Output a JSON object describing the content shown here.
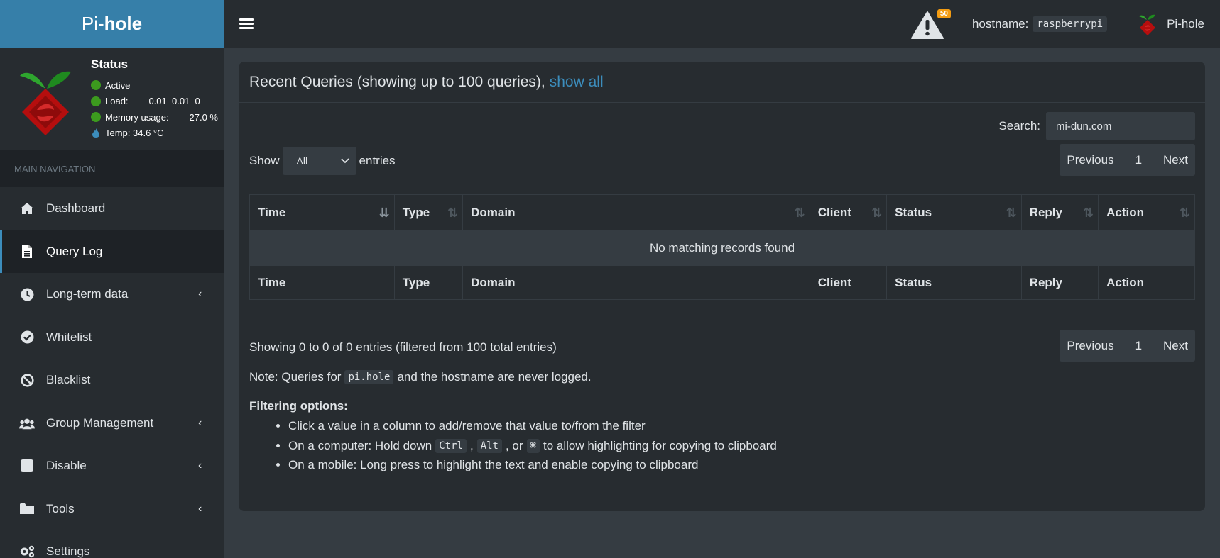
{
  "brand": {
    "pi": "Pi-",
    "hole": "hole"
  },
  "status": {
    "title": "Status",
    "active": "Active",
    "load_label": "Load:",
    "load_value": "0.01  0.01  0",
    "memory_label": "Memory usage:",
    "memory_value": "27.0 %",
    "temp": "Temp: 34.6 °C",
    "colors": {
      "ok": "#3c9a1e",
      "temp": "#3c8dbc"
    }
  },
  "nav": {
    "header": "MAIN NAVIGATION",
    "items": [
      {
        "label": "Dashboard",
        "icon": "home-icon",
        "chevron": false,
        "active": false
      },
      {
        "label": "Query Log",
        "icon": "file-icon",
        "chevron": false,
        "active": true
      },
      {
        "label": "Long-term data",
        "icon": "clock-icon",
        "chevron": true,
        "active": false
      },
      {
        "label": "Whitelist",
        "icon": "check-circle-icon",
        "chevron": false,
        "active": false
      },
      {
        "label": "Blacklist",
        "icon": "ban-icon",
        "chevron": false,
        "active": false
      },
      {
        "label": "Group Management",
        "icon": "users-icon",
        "chevron": true,
        "active": false
      },
      {
        "label": "Disable",
        "icon": "stop-icon",
        "chevron": true,
        "active": false
      },
      {
        "label": "Tools",
        "icon": "folder-icon",
        "chevron": true,
        "active": false
      },
      {
        "label": "Settings",
        "icon": "gears-icon",
        "chevron": false,
        "active": false
      }
    ]
  },
  "topbar": {
    "warning_count": "50",
    "hostname_label": "hostname:",
    "hostname_value": "raspberrypi",
    "user_label": "Pi-hole"
  },
  "box": {
    "title": "Recent Queries (showing up to 100 queries),",
    "show_all": "show all",
    "search_label": "Search:",
    "search_value": "mi-dun.com",
    "show_label": "Show",
    "show_select": "All",
    "entries_label": "entries",
    "pager": {
      "previous": "Previous",
      "page": "1",
      "next": "Next"
    },
    "columns": [
      "Time",
      "Type",
      "Domain",
      "Client",
      "Status",
      "Reply",
      "Action"
    ],
    "empty_message": "No matching records found",
    "info": "Showing 0 to 0 of 0 entries (filtered from 100 total entries)",
    "note_prefix": "Note: Queries for",
    "note_code": "pi.hole",
    "note_suffix": "and the hostname are never logged.",
    "filter_title": "Filtering options:",
    "filter_1": "Click a value in a column to add/remove that value to/from the filter",
    "filter_2_prefix": "On a computer: Hold down",
    "filter_2_key1": "Ctrl",
    "filter_2_sep": ",",
    "filter_2_key2": "Alt",
    "filter_2_or": ", or",
    "filter_2_key3": "⌘",
    "filter_2_suffix": "to allow highlighting for copying to clipboard",
    "filter_3": "On a mobile: Long press to highlight the text and enable copying to clipboard"
  }
}
